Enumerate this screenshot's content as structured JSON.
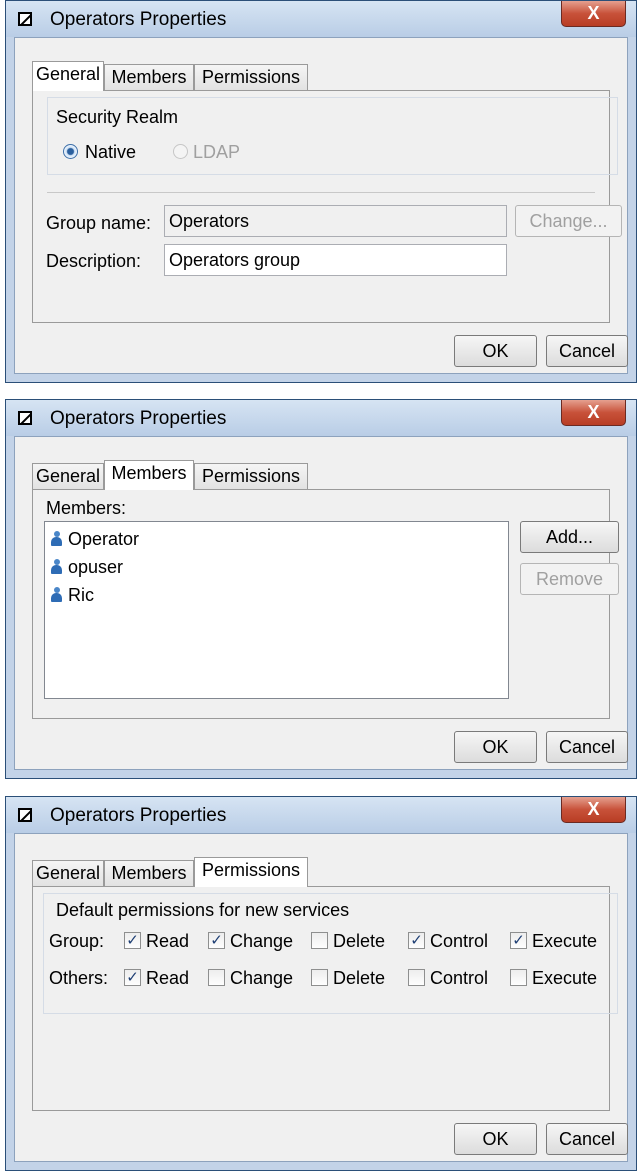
{
  "dialogs": [
    {
      "title": "Operators Properties",
      "close_glyph": "X",
      "tabs": [
        "General",
        "Members",
        "Permissions"
      ],
      "active_tab": "General",
      "security_realm": {
        "legend": "Security Realm",
        "options": [
          "Native",
          "LDAP"
        ],
        "selected": "Native"
      },
      "group_name_label": "Group name:",
      "group_name_value": "Operators",
      "change_button": "Change...",
      "description_label": "Description:",
      "description_value": "Operators group",
      "ok_button": "OK",
      "cancel_button": "Cancel"
    },
    {
      "title": "Operators Properties",
      "close_glyph": "X",
      "tabs": [
        "General",
        "Members",
        "Permissions"
      ],
      "active_tab": "Members",
      "members_label": "Members:",
      "members": [
        "Operator",
        "opuser",
        "Ric"
      ],
      "add_button": "Add...",
      "remove_button": "Remove",
      "ok_button": "OK",
      "cancel_button": "Cancel"
    },
    {
      "title": "Operators Properties",
      "close_glyph": "X",
      "tabs": [
        "General",
        "Members",
        "Permissions"
      ],
      "active_tab": "Permissions",
      "permissions_legend": "Default permissions for new services",
      "permission_names": [
        "Read",
        "Change",
        "Delete",
        "Control",
        "Execute"
      ],
      "rows": [
        {
          "label": "Group:",
          "checked": [
            true,
            true,
            false,
            true,
            true
          ]
        },
        {
          "label": "Others:",
          "checked": [
            true,
            false,
            false,
            false,
            false
          ]
        }
      ],
      "ok_button": "OK",
      "cancel_button": "Cancel"
    }
  ],
  "icons": {
    "title": "window-app-icon",
    "close": "close-icon",
    "member": "user-icon",
    "check_glyph": "✓"
  },
  "colors": {
    "frame": "#c3d3e8",
    "close_button": "#c8523a",
    "client": "#f0f0f0"
  }
}
